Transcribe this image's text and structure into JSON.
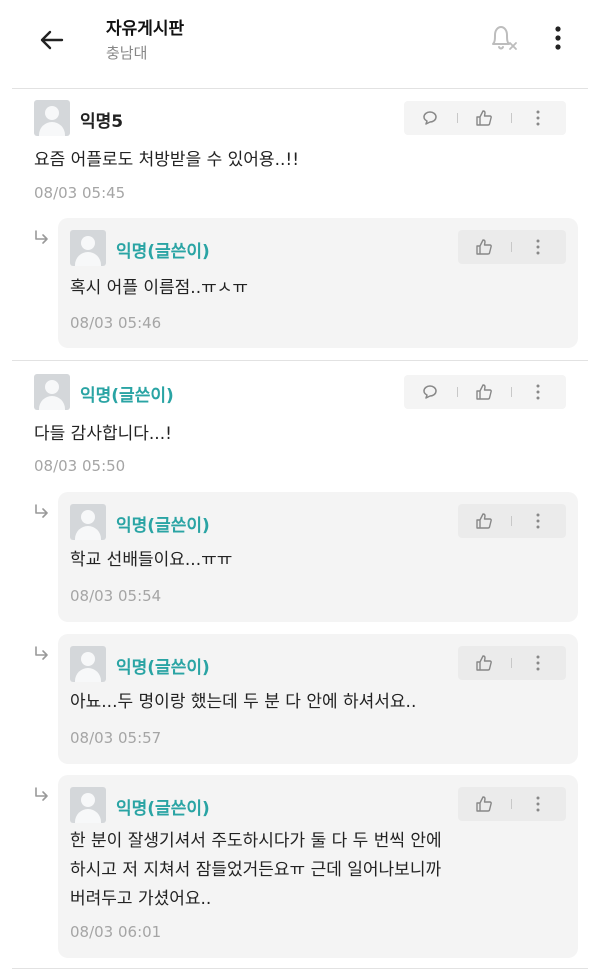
{
  "header": {
    "title": "자유게시판",
    "subtitle": "충남대"
  },
  "comments": [
    {
      "nickname": "익명5",
      "text": "요즘 어플로도 처방받을 수 있어용..!!",
      "time": "08/03 05:45",
      "replies": [
        {
          "nickname": "익명(글쓴이)",
          "text": "혹시 어플 이름점..ㅠㅅㅠ",
          "time": "08/03 05:46"
        }
      ]
    },
    {
      "nickname": "익명(글쓴이)",
      "text": "다들 감사합니다...!",
      "time": "08/03 05:50",
      "replies": [
        {
          "nickname": "익명(글쓴이)",
          "text": "학교 선배들이요...ㅠㅠ",
          "time": "08/03 05:54"
        },
        {
          "nickname": "익명(글쓴이)",
          "text": "아뇨...두 명이랑 했는데 두 분 다 안에 하셔서요..",
          "time": "08/03 05:57"
        },
        {
          "nickname": "익명(글쓴이)",
          "text": "한 분이 잘생기셔서 주도하시다가 둘 다 두 번씩 안에\n하시고 저 지쳐서 잠들었거든요ㅠ 근데 일어나보니까\n버려두고 가셨어요..",
          "time": "08/03 06:01"
        }
      ]
    }
  ],
  "icons": {
    "back": "back-arrow-icon",
    "bell": "bell-off-icon",
    "more": "more-vertical-icon",
    "comment": "comment-icon",
    "like": "thumbs-up-icon",
    "reply": "reply-arrow-icon"
  },
  "colors": {
    "writer_nickname": "#2aa4a4",
    "timestamp": "#a5a5a5",
    "reply_background": "#f4f4f4"
  }
}
